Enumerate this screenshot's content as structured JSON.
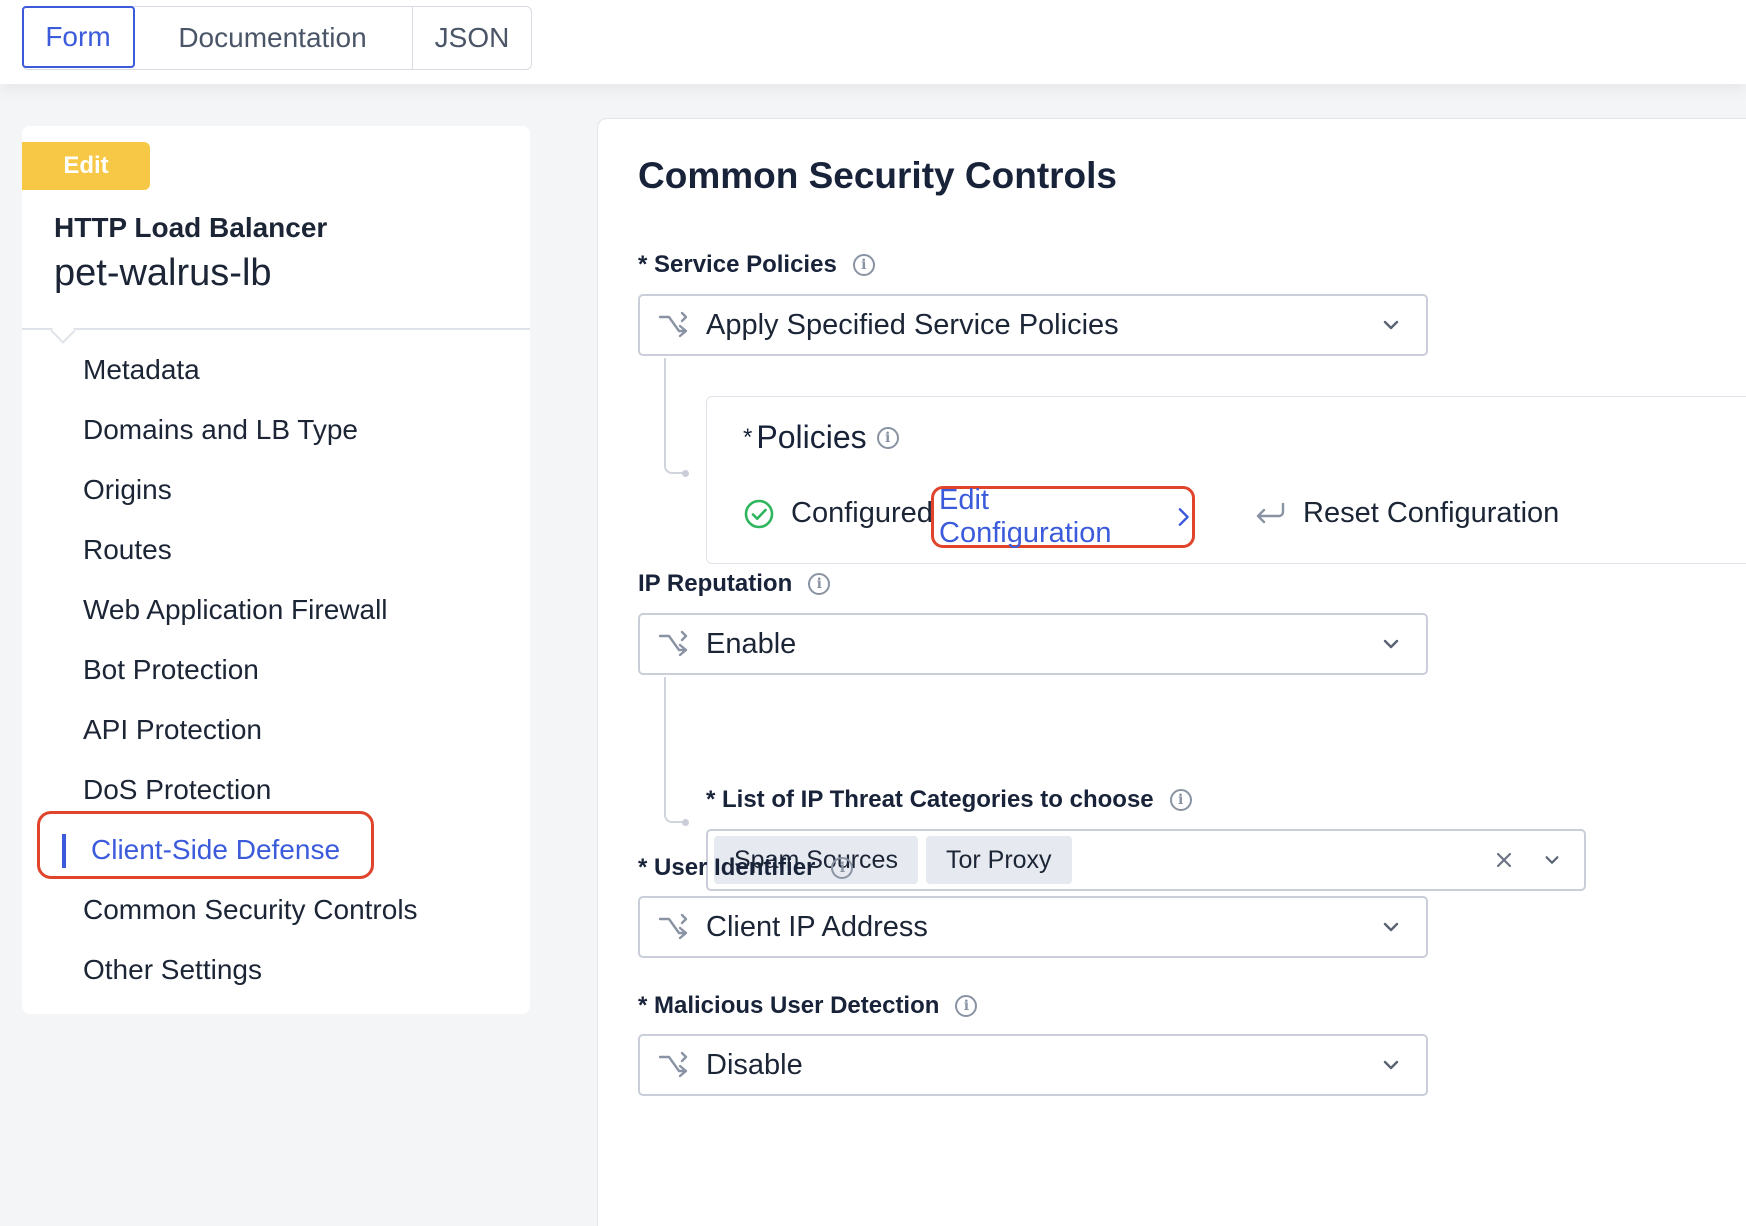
{
  "tabs": [
    {
      "label": "Form",
      "active": true
    },
    {
      "label": "Documentation",
      "active": false
    },
    {
      "label": "JSON",
      "active": false
    }
  ],
  "sidebar": {
    "badge": "Edit",
    "object_type": "HTTP Load Balancer",
    "object_name": "pet-walrus-lb",
    "items": [
      {
        "label": "Metadata"
      },
      {
        "label": "Domains and LB Type"
      },
      {
        "label": "Origins"
      },
      {
        "label": "Routes"
      },
      {
        "label": "Web Application Firewall"
      },
      {
        "label": "Bot Protection"
      },
      {
        "label": "API Protection"
      },
      {
        "label": "DoS Protection"
      },
      {
        "label": "Client-Side Defense",
        "active": true
      },
      {
        "label": "Common Security Controls"
      },
      {
        "label": "Other Settings"
      }
    ]
  },
  "main": {
    "title": "Common Security Controls",
    "service_policies": {
      "label": "* Service Policies",
      "value": "Apply Specified Service Policies"
    },
    "policies": {
      "required_mark": "*",
      "title": "Policies",
      "status": "Configured",
      "edit_label": "Edit Configuration",
      "reset_label": "Reset Configuration"
    },
    "ip_reputation": {
      "label": "IP Reputation",
      "value": "Enable"
    },
    "ip_threat_categories": {
      "label": "* List of IP Threat Categories to choose",
      "chips": [
        "Spam Sources",
        "Tor Proxy"
      ]
    },
    "user_identifier": {
      "label": "* User Identifier",
      "value": "Client IP Address"
    },
    "malicious_user_detection": {
      "label": "* Malicious User Detection",
      "value": "Disable"
    }
  },
  "colors": {
    "accent": "#3b5bdb",
    "highlight_outline": "#e0442b",
    "edit_badge": "#f6c845",
    "success": "#2fb55d"
  },
  "icons": {
    "info": "info-icon",
    "select_type": "branch-icon",
    "chevron": "chevron-down-icon",
    "configured": "check-circle-icon",
    "edit_arrow": "chevron-right-icon",
    "reset": "undo-arrow-icon",
    "clear": "close-icon"
  }
}
